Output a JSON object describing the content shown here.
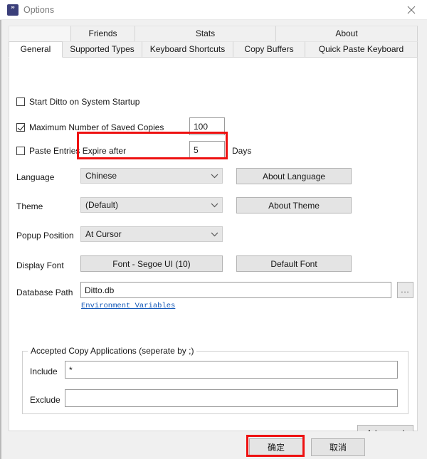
{
  "window": {
    "title": "Options",
    "icon": "ditto-app-icon",
    "icon_glyph": "”",
    "close_icon": "close-icon",
    "accent_highlight": "#ee1111",
    "icon_color": "#3b3f7a"
  },
  "tabs": {
    "row1": [
      {
        "label": "",
        "kind": "spacer"
      },
      {
        "label": "Friends",
        "kind": "tab"
      },
      {
        "label": "Stats",
        "kind": "tab"
      },
      {
        "label": "About",
        "kind": "tab"
      }
    ],
    "row2": [
      {
        "label": "General",
        "kind": "tab",
        "selected": true
      },
      {
        "label": "Supported Types",
        "kind": "tab"
      },
      {
        "label": "Keyboard Shortcuts",
        "kind": "tab"
      },
      {
        "label": "Copy Buffers",
        "kind": "tab"
      },
      {
        "label": "Quick Paste Keyboard",
        "kind": "tab"
      }
    ]
  },
  "general": {
    "checkboxes": [
      {
        "label": "Start Ditto on System Startup",
        "checked": false
      },
      {
        "label": "Maximum Number of Saved Copies",
        "checked": true
      },
      {
        "label": "Paste Entries Expire after",
        "checked": false
      }
    ],
    "max_copies_value": "100",
    "expire_days_value": "5",
    "days_label": "Days",
    "language": {
      "label": "Language",
      "value": "Chinese",
      "button": "About Language",
      "highlighted": true
    },
    "theme": {
      "label": "Theme",
      "value": "(Default)",
      "button": "About Theme"
    },
    "popup_position": {
      "label": "Popup Position",
      "value": "At Cursor"
    },
    "display_font": {
      "label": "Display Font",
      "button": "Font - Segoe UI (10)",
      "default_button": "Default Font"
    },
    "database_path": {
      "label": "Database Path",
      "value": "Ditto.db",
      "browse_label": "...",
      "env_link": "Environment Variables"
    },
    "accepted_apps": {
      "title": "Accepted Copy Applications (seperate by ;)",
      "include_label": "Include",
      "include_value": "*",
      "exclude_label": "Exclude",
      "exclude_value": ""
    },
    "advanced_button": "Advanced"
  },
  "footer": {
    "ok_button": "确定",
    "cancel_button": "取消",
    "ok_highlighted": true
  }
}
